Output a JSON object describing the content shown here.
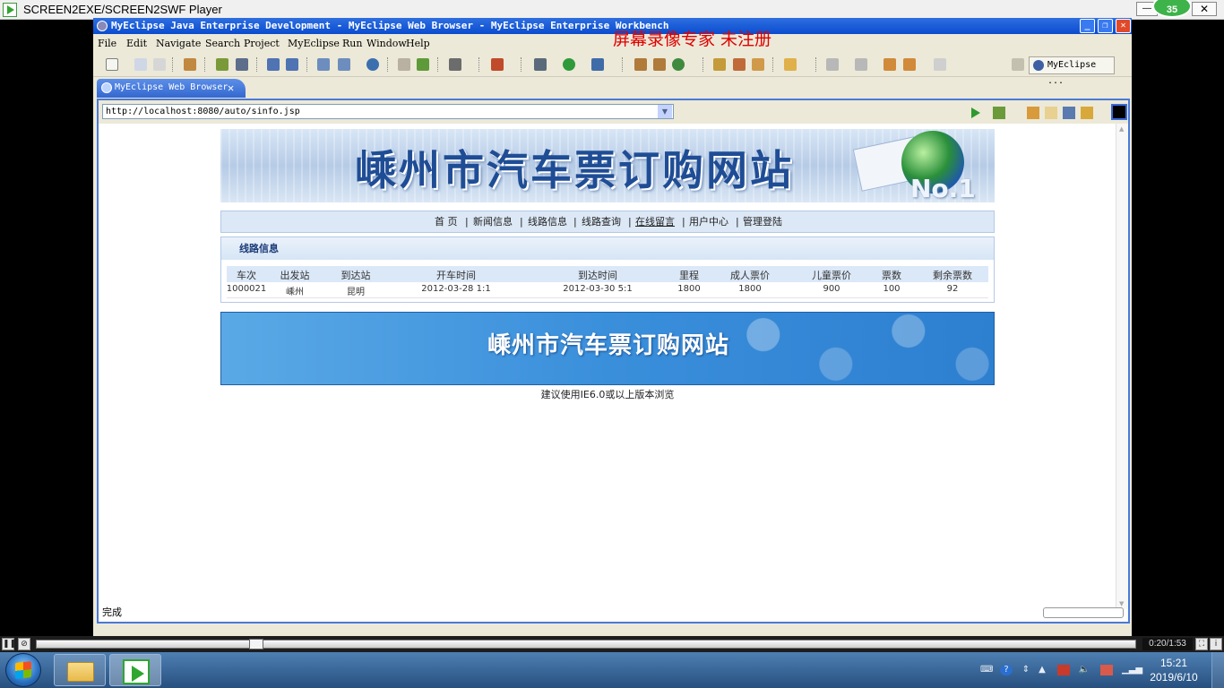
{
  "player": {
    "title": "SCREEN2EXE/SCREEN2SWF Player",
    "badge": "35",
    "time": "0:20/1:53",
    "progress_fraction": 0.2
  },
  "ide": {
    "title": "MyEclipse Java Enterprise Development - MyEclipse Web Browser - MyEclipse Enterprise Workbench",
    "watermark": "屏幕录像专家  未注册",
    "menu": [
      "File",
      "Edit",
      "Navigate",
      "Search",
      "Project",
      "MyEclipse",
      "Run",
      "Window",
      "Help"
    ],
    "perspective": "MyEclipse ...",
    "tab_label": "MyEclipse Web Browser",
    "url": "http://localhost:8080/auto/sinfo.jsp",
    "status": "完成"
  },
  "site": {
    "banner_title": "嵊州市汽车票订购网站",
    "banner_badge": "No.1",
    "nav": [
      "首 页",
      "新闻信息",
      "线路信息",
      "线路查询",
      "在线留言",
      "用户中心",
      "管理登陆"
    ],
    "panel_title": "线路信息",
    "columns": [
      "车次",
      "出发站",
      "到达站",
      "开车时间",
      "到达时间",
      "里程",
      "成人票价",
      "儿童票价",
      "票数",
      "剩余票数"
    ],
    "rows": [
      [
        "1000021",
        "嵊州",
        "昆明",
        "2012-03-28 1:1",
        "2012-03-30 5:1",
        "1800",
        "1800",
        "900",
        "100",
        "92"
      ]
    ],
    "footer_title": "嵊州市汽车票订购网站",
    "footer_note": "建议使用IE6.0或以上版本浏览"
  },
  "taskbar": {
    "time": "15:21",
    "date": "2019/6/10"
  }
}
